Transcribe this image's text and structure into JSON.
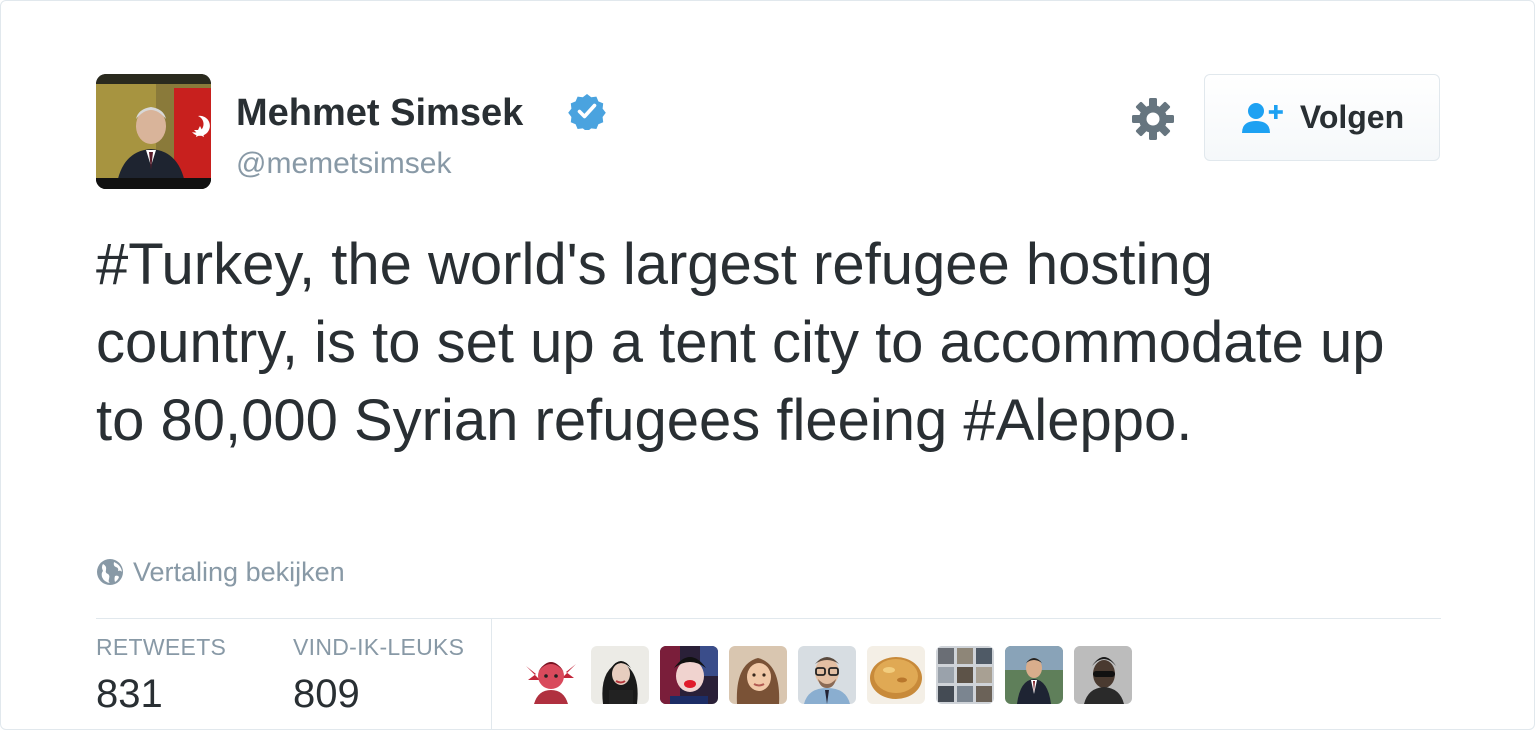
{
  "author": {
    "name": "Mehmet Simsek",
    "handle": "@memetsimsek",
    "verified": true,
    "avatar_icon": "profile-photo"
  },
  "actions": {
    "settings_icon": "gear-icon",
    "follow_label": "Volgen",
    "follow_icon": "add-user-icon"
  },
  "tweet": {
    "text": "#Turkey, the world's largest refugee hosting country, is to set up a tent city to accommodate up to 80,000 Syrian refugees fleeing #Aleppo."
  },
  "translate": {
    "label": "Vertaling bekijken",
    "icon": "globe-icon"
  },
  "stats": {
    "retweets_label": "RETWEETS",
    "retweets_value": "831",
    "likes_label": "VIND-IK-LEUKS",
    "likes_value": "809"
  },
  "likers_count_shown": 9,
  "colors": {
    "text": "#292f33",
    "muted": "#8899a6",
    "accent": "#1da1f2",
    "verified": "#4aa3df",
    "border": "#e1e8ed"
  }
}
